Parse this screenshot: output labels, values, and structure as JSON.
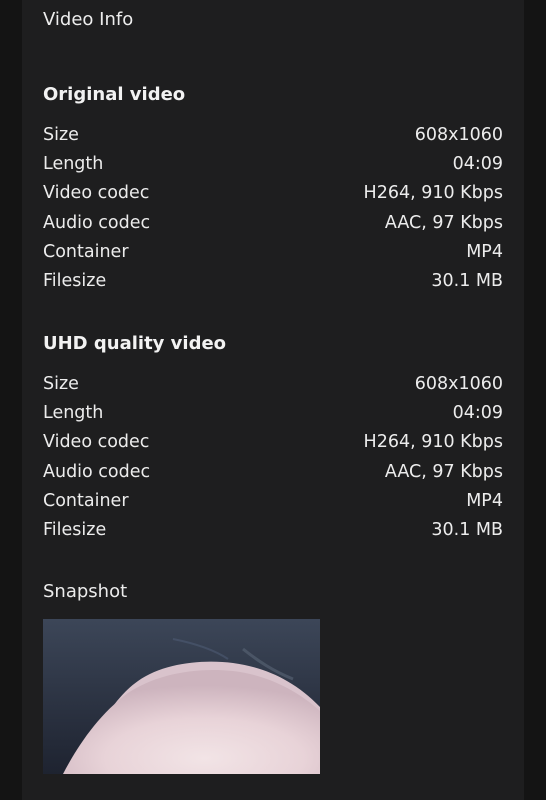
{
  "panel": {
    "title": "Video Info"
  },
  "original": {
    "title": "Original video",
    "rows": [
      {
        "label": "Size",
        "value": "608x1060"
      },
      {
        "label": "Length",
        "value": "04:09"
      },
      {
        "label": "Video codec",
        "value": "H264, 910 Kbps"
      },
      {
        "label": "Audio codec",
        "value": "AAC, 97 Kbps"
      },
      {
        "label": "Container",
        "value": "MP4"
      },
      {
        "label": "Filesize",
        "value": "30.1 MB"
      }
    ]
  },
  "uhd": {
    "title": "UHD quality video",
    "rows": [
      {
        "label": "Size",
        "value": "608x1060"
      },
      {
        "label": "Length",
        "value": "04:09"
      },
      {
        "label": "Video codec",
        "value": "H264, 910 Kbps"
      },
      {
        "label": "Audio codec",
        "value": "AAC, 97 Kbps"
      },
      {
        "label": "Container",
        "value": "MP4"
      },
      {
        "label": "Filesize",
        "value": "30.1 MB"
      }
    ]
  },
  "snapshot": {
    "title": "Snapshot"
  }
}
